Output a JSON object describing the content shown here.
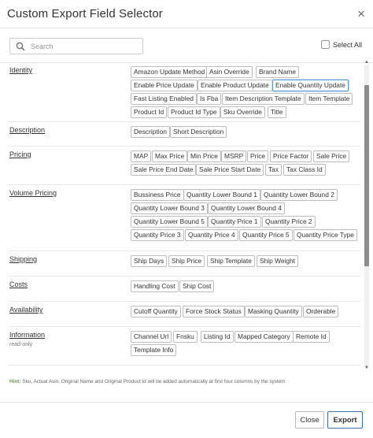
{
  "dialog": {
    "title": "Custom Export Field Selector",
    "close_icon": "close-icon"
  },
  "toolbar": {
    "search_placeholder": "Search",
    "search_value": "",
    "select_all_label": "Select All",
    "select_all_checked": false
  },
  "sections": [
    {
      "label": "Identity",
      "sub": "",
      "fields": [
        "Amazon Update Method",
        "Asin Override",
        "Brand Name",
        "Enable Price Update",
        "Enable Product Update",
        "Enable Quantity Update",
        "Fast Listing Enabled",
        "Is Fba",
        "Item Description Template",
        "Item Template",
        "Product Id",
        "Product Id Type",
        "Sku Override",
        "Title"
      ],
      "active": "Enable Quantity Update"
    },
    {
      "label": "Description",
      "sub": "",
      "fields": [
        "Description",
        "Short Description"
      ]
    },
    {
      "label": "Pricing",
      "sub": "",
      "fields": [
        "MAP",
        "Max Price",
        "Min Price",
        "MSRP",
        "Price",
        "Price Factor",
        "Sale Price",
        "Sale Price End Date",
        "Sale Price Start Date",
        "Tax",
        "Tax Class Id"
      ]
    },
    {
      "label": "Volume Pricing",
      "sub": "",
      "fields": [
        "Bussiness Price",
        "Quantity Lower Bound 1",
        "Quantity Lower Bound 2",
        "Quantity Lower Bound 3",
        "Quantity Lower Bound 4",
        "Quantity Lower Bound 5",
        "Quantity Price 1",
        "Quantity Price 2",
        "Quantity Price 3",
        "Quantity Price 4",
        "Quantity Price 5",
        "Quantity Price Type"
      ]
    },
    {
      "label": "Shipping",
      "sub": "",
      "fields": [
        "Ship Days",
        "Ship Price",
        "Ship Template",
        "Ship Weight"
      ]
    },
    {
      "label": "Costs",
      "sub": "",
      "fields": [
        "Handling Cost",
        "Ship Cost"
      ]
    },
    {
      "label": "Availability",
      "sub": "",
      "fields": [
        "Cutoff Quantity",
        "Force Stock Status",
        "Masking Quantity",
        "Orderable"
      ]
    },
    {
      "label": "Information",
      "sub": "read-only",
      "fields": [
        "Channel Url",
        "Fnsku",
        "Listing Id",
        "Mapped Category",
        "Remote Id",
        "Template Info"
      ]
    }
  ],
  "hint": {
    "label": "Hint:",
    "text": " Sku, Actual Asin, Original Name and Original Product Id will be added automatically at first four columns by the system"
  },
  "footer": {
    "close_label": "Close",
    "export_label": "Export"
  },
  "colors": {
    "accent": "#3a6fb0",
    "hint_green": "#5aa832",
    "chip_active": "#5b9bd5"
  }
}
